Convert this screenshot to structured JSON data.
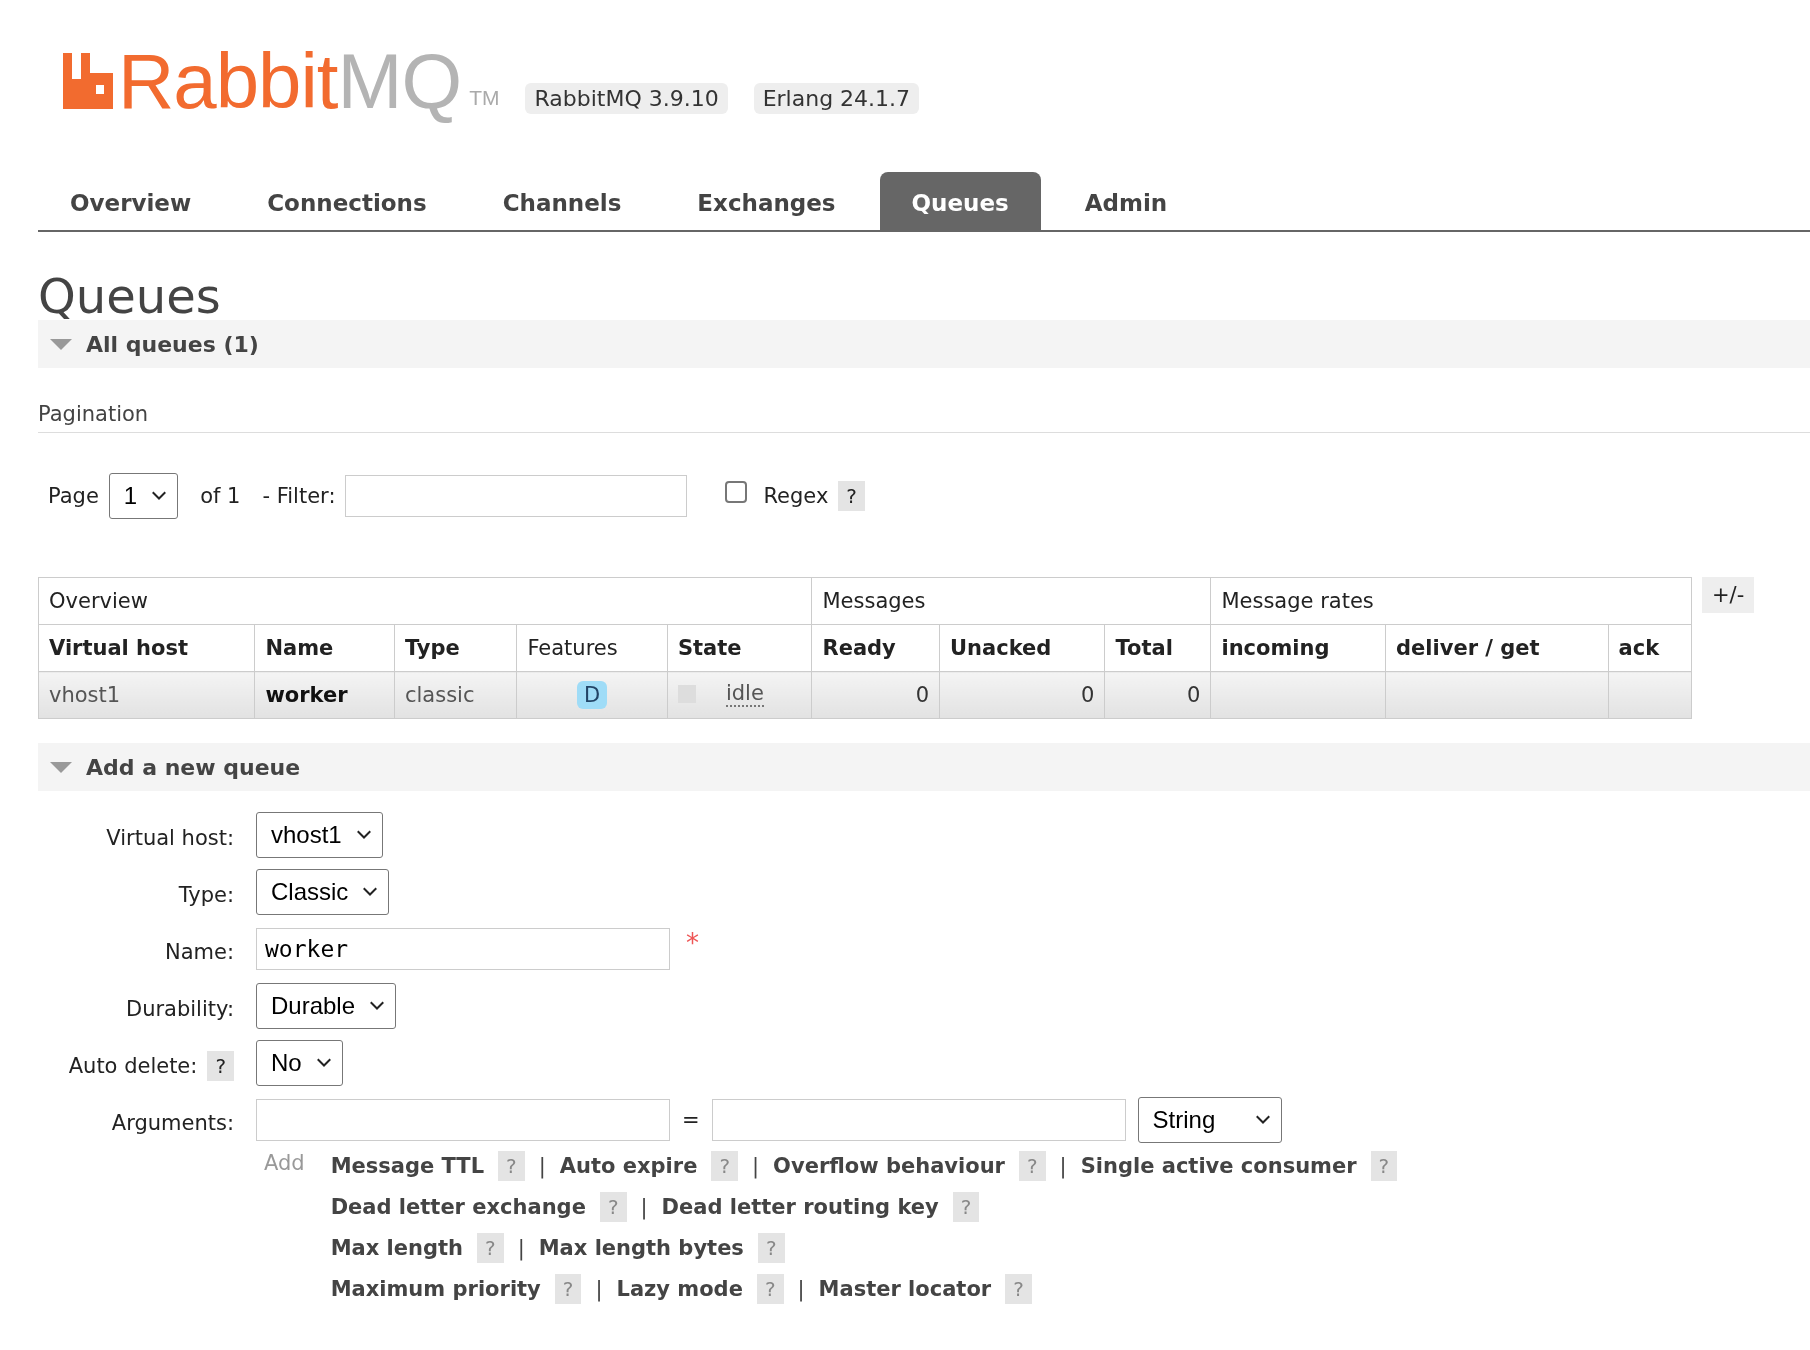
{
  "header": {
    "logo_primary": "Rabbit",
    "logo_secondary": "MQ",
    "trademark": "TM",
    "versions": [
      "RabbitMQ 3.9.10",
      "Erlang 24.1.7"
    ]
  },
  "tabs": [
    {
      "label": "Overview",
      "selected": false
    },
    {
      "label": "Connections",
      "selected": false
    },
    {
      "label": "Channels",
      "selected": false
    },
    {
      "label": "Exchanges",
      "selected": false
    },
    {
      "label": "Queues",
      "selected": true
    },
    {
      "label": "Admin",
      "selected": false
    }
  ],
  "page_title": "Queues",
  "all_queues": {
    "title": "All queues (1)",
    "expanded": true,
    "pagination": {
      "heading": "Pagination",
      "page_label": "Page",
      "page_value": "1",
      "of_label": "of 1",
      "filter_label": "- Filter:",
      "regex_label": "Regex",
      "regex_checked": false,
      "help": "?"
    },
    "table": {
      "groups": [
        {
          "label": "Overview",
          "columns": [
            {
              "label": "Virtual host",
              "bold": true
            },
            {
              "label": "Name",
              "bold": true
            },
            {
              "label": "Type",
              "bold": true
            },
            {
              "label": "Features",
              "bold": false
            },
            {
              "label": "State",
              "bold": true
            }
          ]
        },
        {
          "label": "Messages",
          "columns": [
            {
              "label": "Ready",
              "bold": true
            },
            {
              "label": "Unacked",
              "bold": true
            },
            {
              "label": "Total",
              "bold": true
            }
          ]
        },
        {
          "label": "Message rates",
          "columns": [
            {
              "label": "incoming",
              "bold": true
            },
            {
              "label": "deliver / get",
              "bold": true
            },
            {
              "label": "ack",
              "bold": true
            }
          ]
        }
      ],
      "rows": [
        {
          "cells": [
            {
              "kind": "text",
              "text": "vhost1"
            },
            {
              "kind": "bold",
              "text": "worker"
            },
            {
              "kind": "text",
              "text": "classic"
            },
            {
              "kind": "badge",
              "text": "D"
            },
            {
              "kind": "state",
              "text": "idle"
            },
            {
              "kind": "number",
              "text": "0"
            },
            {
              "kind": "number",
              "text": "0"
            },
            {
              "kind": "number",
              "text": "0"
            },
            {
              "kind": "empty"
            },
            {
              "kind": "empty"
            },
            {
              "kind": "empty"
            }
          ]
        }
      ],
      "toggle_columns": "+/-"
    }
  },
  "add_queue": {
    "title": "Add a new queue",
    "expanded": true,
    "fields": [
      {
        "kind": "select",
        "label": "Virtual host:",
        "value": "vhost1"
      },
      {
        "kind": "select",
        "label": "Type:",
        "value": "Classic"
      },
      {
        "kind": "input",
        "label": "Name:",
        "value": "worker",
        "required_mark": "*"
      },
      {
        "kind": "select",
        "label": "Durability:",
        "value": "Durable"
      },
      {
        "kind": "select",
        "label": "Auto delete:",
        "help": "?",
        "value": "No"
      },
      {
        "kind": "arguments",
        "label": "Arguments:",
        "separator": "=",
        "type_value": "String"
      }
    ],
    "add_label": "Add",
    "argument_lines": [
      {
        "items": [
          {
            "label": "Message TTL",
            "help": "?",
            "separator": "|"
          },
          {
            "label": "Auto expire",
            "help": "?",
            "separator": "|"
          },
          {
            "label": "Overflow behaviour",
            "help": "?",
            "separator": "|"
          },
          {
            "label": "Single active consumer",
            "help": "?"
          }
        ]
      },
      {
        "items": [
          {
            "label": "Dead letter exchange",
            "help": "?",
            "separator": "|"
          },
          {
            "label": "Dead letter routing key",
            "help": "?"
          }
        ]
      },
      {
        "items": [
          {
            "label": "Max length",
            "help": "?",
            "separator": "|"
          },
          {
            "label": "Max length bytes",
            "help": "?"
          }
        ]
      },
      {
        "items": [
          {
            "label": "Maximum priority",
            "help": "?",
            "separator": "|"
          },
          {
            "label": "Lazy mode",
            "help": "?",
            "separator": "|"
          },
          {
            "label": "Master locator",
            "help": "?"
          }
        ]
      }
    ]
  }
}
